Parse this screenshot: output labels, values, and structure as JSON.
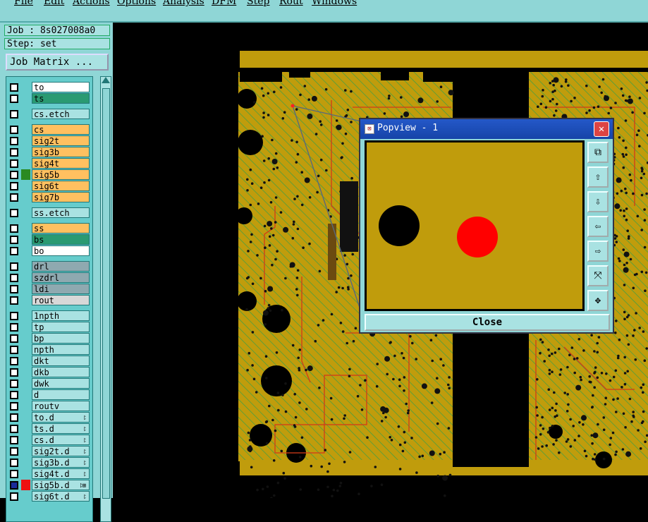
{
  "menu": [
    "File",
    "Edit",
    "Actions",
    "Options",
    "Analysis",
    "DFM",
    "Step",
    "Rout",
    "Windows"
  ],
  "left": {
    "job": "Job : 8s027008a0",
    "step": "Step: set",
    "job_matrix": "Job Matrix ...",
    "layers": [
      {
        "name": "to",
        "color": "#ffffff",
        "ind": ""
      },
      {
        "name": "ts",
        "color": "#2a9a72",
        "ind": ""
      },
      {
        "name": "cs.etch",
        "color": "#a9e2e2",
        "ind": ""
      },
      {
        "name": "cs",
        "color": "#ffc060",
        "ind": ""
      },
      {
        "name": "sig2t",
        "color": "#ffc060",
        "ind": ""
      },
      {
        "name": "sig3b",
        "color": "#ffc060",
        "ind": ""
      },
      {
        "name": "sig4t",
        "color": "#ffc060",
        "ind": ""
      },
      {
        "name": "sig5b",
        "color": "#ffc060",
        "ind": "#2a8a22"
      },
      {
        "name": "sig6t",
        "color": "#ffc060",
        "ind": ""
      },
      {
        "name": "sig7b",
        "color": "#ffc060",
        "ind": ""
      },
      {
        "name": "ss.etch",
        "color": "#a9e2e2",
        "ind": ""
      },
      {
        "name": "ss",
        "color": "#ffc060",
        "ind": ""
      },
      {
        "name": "bs",
        "color": "#2a9a72",
        "ind": ""
      },
      {
        "name": "bo",
        "color": "#ffffff",
        "ind": ""
      },
      {
        "name": "drl",
        "color": "#8fa9b0",
        "ind": ""
      },
      {
        "name": "szdrl",
        "color": "#8fa9b0",
        "ind": ""
      },
      {
        "name": "ldi",
        "color": "#8fa9b0",
        "ind": ""
      },
      {
        "name": "rout",
        "color": "#d8d8d8",
        "ind": ""
      },
      {
        "name": "1npth",
        "color": "#a9e2e2",
        "ind": ""
      },
      {
        "name": "tp",
        "color": "#a9e2e2",
        "ind": ""
      },
      {
        "name": "bp",
        "color": "#a9e2e2",
        "ind": ""
      },
      {
        "name": "npth",
        "color": "#a9e2e2",
        "ind": ""
      },
      {
        "name": "dkt",
        "color": "#a9e2e2",
        "ind": ""
      },
      {
        "name": "dkb",
        "color": "#a9e2e2",
        "ind": ""
      },
      {
        "name": "dwk",
        "color": "#a9e2e2",
        "ind": ""
      },
      {
        "name": "d",
        "color": "#a9e2e2",
        "ind": ""
      },
      {
        "name": "routv",
        "color": "#a9e2e2",
        "ind": ""
      },
      {
        "name": "to.d",
        "color": "#a9e2e2",
        "ind": "",
        "mark": "⥏"
      },
      {
        "name": "ts.d",
        "color": "#a9e2e2",
        "ind": "",
        "mark": "⥏"
      },
      {
        "name": "cs.d",
        "color": "#a9e2e2",
        "ind": "",
        "mark": "⥏"
      },
      {
        "name": "sig2t.d",
        "color": "#a9e2e2",
        "ind": "",
        "mark": "⥏"
      },
      {
        "name": "sig3b.d",
        "color": "#a9e2e2",
        "ind": "",
        "mark": "⥏"
      },
      {
        "name": "sig4t.d",
        "color": "#a9e2e2",
        "ind": "",
        "mark": "⥏"
      },
      {
        "name": "sig5b.d",
        "color": "#a9e2e2",
        "ind": "#ee1111",
        "mark": "⥏⊞",
        "active": true
      },
      {
        "name": "sig6t.d",
        "color": "#a9e2e2",
        "ind": "",
        "mark": "⥏"
      }
    ]
  },
  "popup": {
    "title": "Popview - 1",
    "close_label": "Close",
    "tools": [
      "zoom-fit-icon",
      "pan-up-icon",
      "pan-down-icon",
      "pan-left-icon",
      "pan-right-icon",
      "zoom-out-icon",
      "zoom-in-icon"
    ]
  },
  "colors": {
    "board": "#c09c0c",
    "trace": "#d23a1a",
    "copper_hatch": "#3aa048",
    "background": "#000000",
    "panel": "#8fd6d6"
  }
}
